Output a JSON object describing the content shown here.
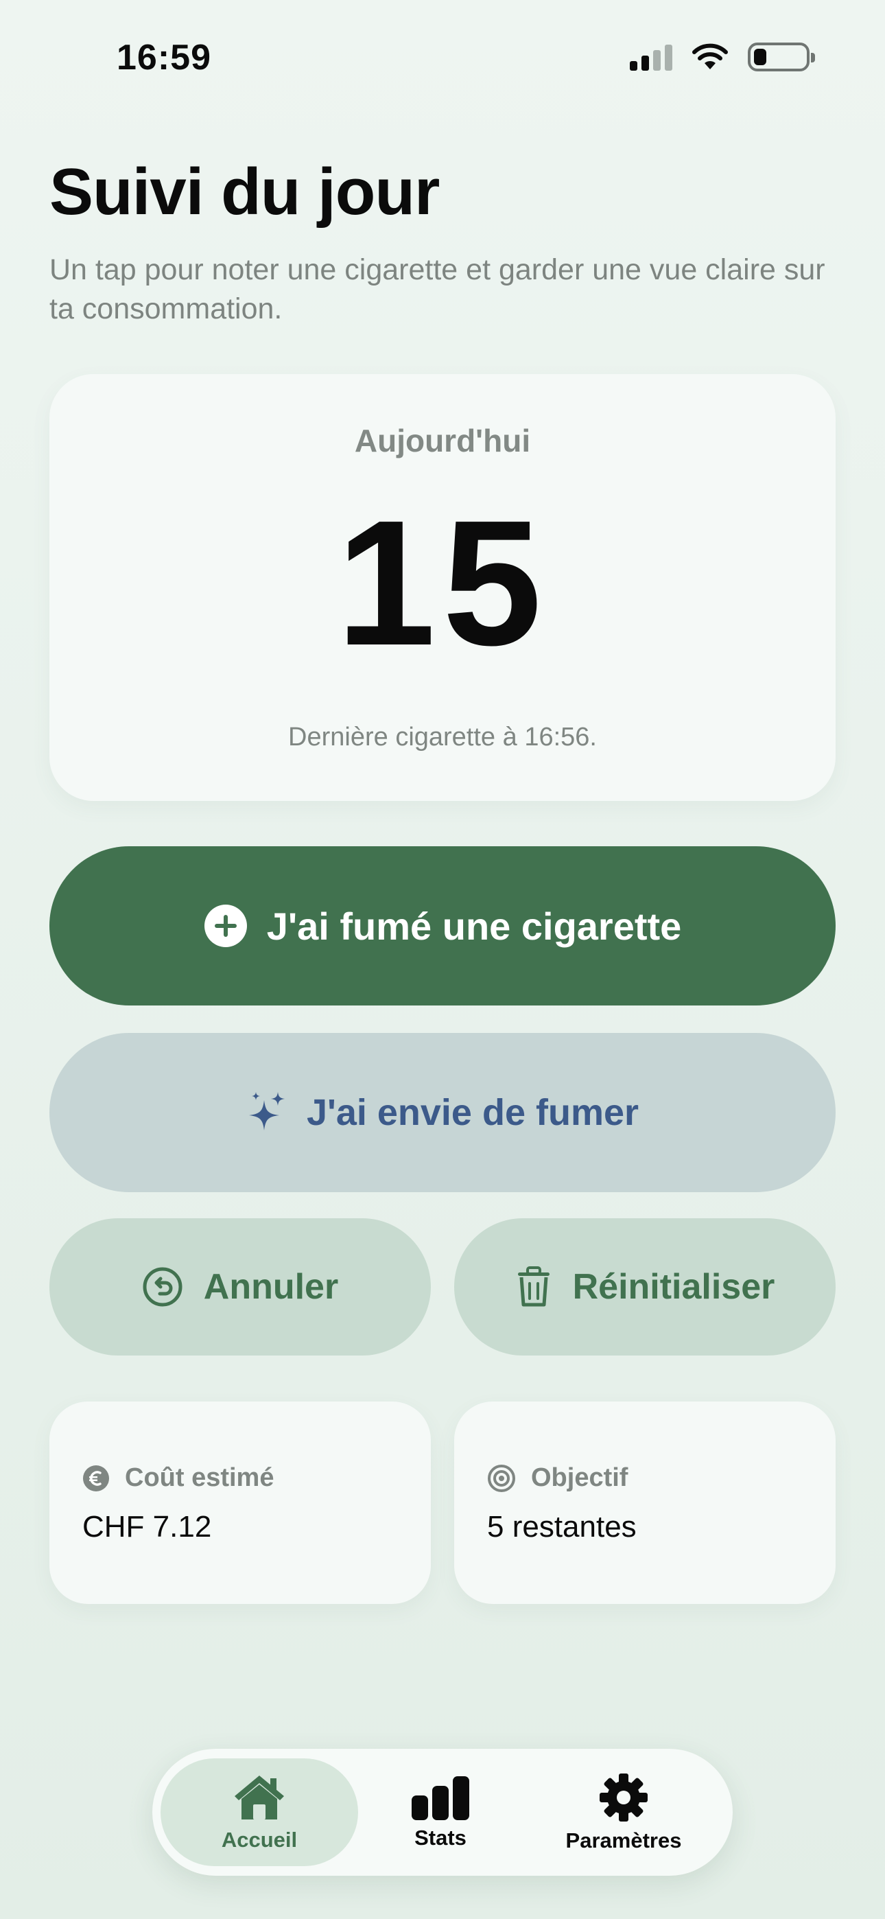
{
  "status_bar": {
    "time": "16:59",
    "signal_icon": "cellular-signal-icon",
    "wifi_icon": "wifi-icon",
    "battery_icon": "battery-low-icon"
  },
  "header": {
    "title": "Suivi du jour",
    "subtitle": "Un tap pour noter une cigarette et garder une vue claire sur ta consommation."
  },
  "counter": {
    "label": "Aujourd'hui",
    "value": "15",
    "last": "Dernière cigarette à 16:56."
  },
  "actions": {
    "smoked_label": "J'ai fumé une cigarette",
    "smoked_icon": "plus-circle-icon",
    "craving_label": "J'ai envie de fumer",
    "craving_icon": "sparkles-icon",
    "undo_label": "Annuler",
    "undo_icon": "undo-icon",
    "reset_label": "Réinitialiser",
    "reset_icon": "trash-icon"
  },
  "stats": {
    "cost_label": "Coût estimé",
    "cost_value": "CHF 7.12",
    "cost_icon": "euro-coin-icon",
    "goal_label": "Objectif",
    "goal_value": "5 restantes",
    "goal_icon": "target-icon"
  },
  "tabs": [
    {
      "label": "Accueil",
      "icon": "house-icon",
      "active": true
    },
    {
      "label": "Stats",
      "icon": "bar-chart-icon",
      "active": false
    },
    {
      "label": "Paramètres",
      "icon": "gear-icon",
      "active": false
    }
  ],
  "colors": {
    "primary_green": "#41724f",
    "craving_blue": "#3c5a8a",
    "background": "#e8f1ec"
  }
}
